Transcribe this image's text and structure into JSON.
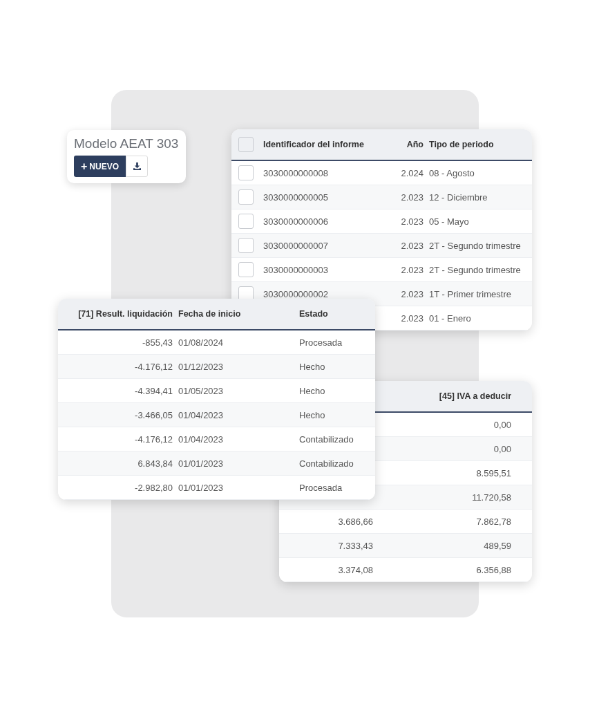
{
  "model_card": {
    "title": "Modelo AEAT 303",
    "new_button": {
      "icon": "+",
      "label": "NUEVO"
    }
  },
  "reports_table": {
    "columns": [
      "Identificador del informe",
      "Año",
      "Tipo de periodo"
    ],
    "header_checked": false,
    "rows": [
      {
        "checked": false,
        "id": "3030000000008",
        "year": "2.024",
        "period": "08 - Agosto"
      },
      {
        "checked": false,
        "id": "3030000000005",
        "year": "2.023",
        "period": "12 - Diciembre"
      },
      {
        "checked": false,
        "id": "3030000000006",
        "year": "2.023",
        "period": "05 - Mayo"
      },
      {
        "checked": false,
        "id": "3030000000007",
        "year": "2.023",
        "period": "2T - Segundo trimestre"
      },
      {
        "checked": false,
        "id": "3030000000003",
        "year": "2.023",
        "period": "2T - Segundo trimestre"
      },
      {
        "checked": false,
        "id": "3030000000002",
        "year": "2.023",
        "period": "1T - Primer trimestre"
      },
      {
        "year": "2.023",
        "period": "01 - Enero"
      }
    ]
  },
  "result_table": {
    "columns": [
      "[71] Result. liquidación",
      "Fecha de inicio",
      "Estado"
    ],
    "rows": [
      {
        "result": "-855,43",
        "date": "01/08/2024",
        "status": "Procesada"
      },
      {
        "result": "-4.176,12",
        "date": "01/12/2023",
        "status": "Hecho"
      },
      {
        "result": "-4.394,41",
        "date": "01/05/2023",
        "status": "Hecho"
      },
      {
        "result": "-3.466,05",
        "date": "01/04/2023",
        "status": "Hecho"
      },
      {
        "result": "-4.176,12",
        "date": "01/04/2023",
        "status": "Contabilizado"
      },
      {
        "result": "6.843,84",
        "date": "01/01/2023",
        "status": "Contabilizado"
      },
      {
        "result": "-2.982,80",
        "date": "01/01/2023",
        "status": "Procesada"
      }
    ]
  },
  "vat_table": {
    "columns": [
      "[45] IVA a deducir"
    ],
    "rows": [
      {
        "iva": "0,00"
      },
      {
        "iva": "0,00"
      },
      {
        "iva": "8.595,51"
      },
      {
        "iva": "11.720,58"
      },
      {
        "column_1": "3.686,66",
        "iva": "7.862,78"
      },
      {
        "column_1": "7.333,43",
        "iva": "489,59"
      },
      {
        "column_1": "3.374,08",
        "iva": "6.356,88"
      }
    ]
  }
}
